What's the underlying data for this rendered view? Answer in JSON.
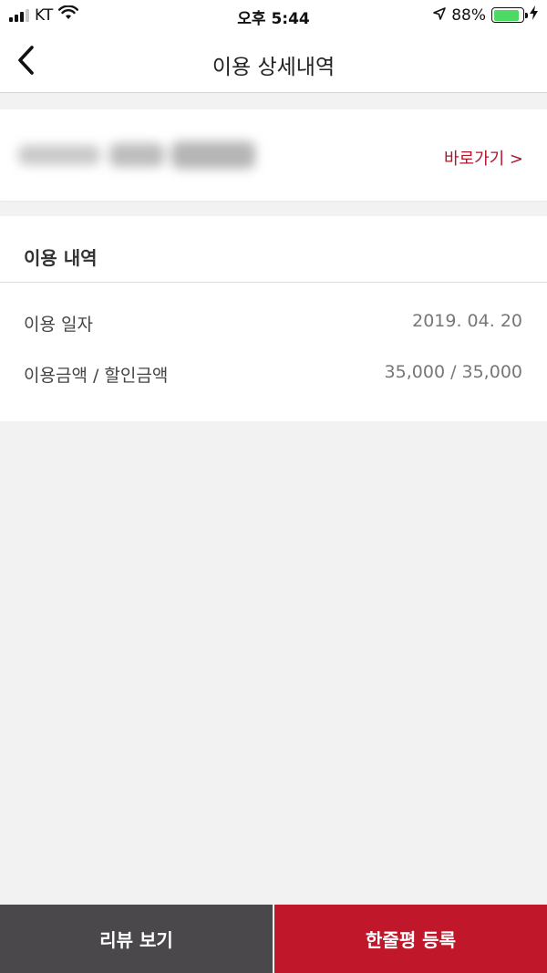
{
  "status_bar": {
    "carrier": "KT",
    "time": "오후 5:44",
    "battery_percent": "88%",
    "battery_level": 0.88,
    "icons": [
      "signal-icon",
      "wifi-icon",
      "location-arrow-icon",
      "battery-icon",
      "charging-bolt-icon"
    ]
  },
  "nav": {
    "title": "이용 상세내역",
    "back_icon": "chevron-left-icon"
  },
  "link_card": {
    "shortcut_label": "바로가기 >"
  },
  "usage": {
    "heading": "이용 내역",
    "rows": [
      {
        "label": "이용 일자",
        "value": "2019. 04. 20"
      },
      {
        "label": "이용금액 / 할인금액",
        "value": "35,000 / 35,000"
      }
    ]
  },
  "actions": {
    "review_label": "리뷰 보기",
    "register_label": "한줄평 등록"
  },
  "colors": {
    "accent": "#c0172b",
    "dark_button": "#4a484b",
    "background": "#f3f2f3"
  }
}
